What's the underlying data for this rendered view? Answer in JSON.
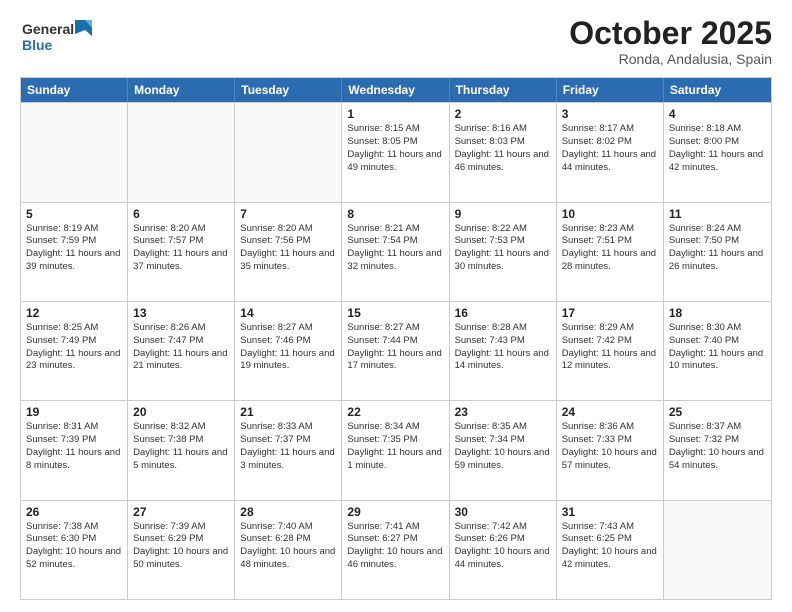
{
  "header": {
    "logo_general": "General",
    "logo_blue": "Blue",
    "month_title": "October 2025",
    "location": "Ronda, Andalusia, Spain"
  },
  "weekdays": [
    "Sunday",
    "Monday",
    "Tuesday",
    "Wednesday",
    "Thursday",
    "Friday",
    "Saturday"
  ],
  "rows": [
    [
      {
        "day": "",
        "text": ""
      },
      {
        "day": "",
        "text": ""
      },
      {
        "day": "",
        "text": ""
      },
      {
        "day": "1",
        "text": "Sunrise: 8:15 AM\nSunset: 8:05 PM\nDaylight: 11 hours and 49 minutes."
      },
      {
        "day": "2",
        "text": "Sunrise: 8:16 AM\nSunset: 8:03 PM\nDaylight: 11 hours and 46 minutes."
      },
      {
        "day": "3",
        "text": "Sunrise: 8:17 AM\nSunset: 8:02 PM\nDaylight: 11 hours and 44 minutes."
      },
      {
        "day": "4",
        "text": "Sunrise: 8:18 AM\nSunset: 8:00 PM\nDaylight: 11 hours and 42 minutes."
      }
    ],
    [
      {
        "day": "5",
        "text": "Sunrise: 8:19 AM\nSunset: 7:59 PM\nDaylight: 11 hours and 39 minutes."
      },
      {
        "day": "6",
        "text": "Sunrise: 8:20 AM\nSunset: 7:57 PM\nDaylight: 11 hours and 37 minutes."
      },
      {
        "day": "7",
        "text": "Sunrise: 8:20 AM\nSunset: 7:56 PM\nDaylight: 11 hours and 35 minutes."
      },
      {
        "day": "8",
        "text": "Sunrise: 8:21 AM\nSunset: 7:54 PM\nDaylight: 11 hours and 32 minutes."
      },
      {
        "day": "9",
        "text": "Sunrise: 8:22 AM\nSunset: 7:53 PM\nDaylight: 11 hours and 30 minutes."
      },
      {
        "day": "10",
        "text": "Sunrise: 8:23 AM\nSunset: 7:51 PM\nDaylight: 11 hours and 28 minutes."
      },
      {
        "day": "11",
        "text": "Sunrise: 8:24 AM\nSunset: 7:50 PM\nDaylight: 11 hours and 26 minutes."
      }
    ],
    [
      {
        "day": "12",
        "text": "Sunrise: 8:25 AM\nSunset: 7:49 PM\nDaylight: 11 hours and 23 minutes."
      },
      {
        "day": "13",
        "text": "Sunrise: 8:26 AM\nSunset: 7:47 PM\nDaylight: 11 hours and 21 minutes."
      },
      {
        "day": "14",
        "text": "Sunrise: 8:27 AM\nSunset: 7:46 PM\nDaylight: 11 hours and 19 minutes."
      },
      {
        "day": "15",
        "text": "Sunrise: 8:27 AM\nSunset: 7:44 PM\nDaylight: 11 hours and 17 minutes."
      },
      {
        "day": "16",
        "text": "Sunrise: 8:28 AM\nSunset: 7:43 PM\nDaylight: 11 hours and 14 minutes."
      },
      {
        "day": "17",
        "text": "Sunrise: 8:29 AM\nSunset: 7:42 PM\nDaylight: 11 hours and 12 minutes."
      },
      {
        "day": "18",
        "text": "Sunrise: 8:30 AM\nSunset: 7:40 PM\nDaylight: 11 hours and 10 minutes."
      }
    ],
    [
      {
        "day": "19",
        "text": "Sunrise: 8:31 AM\nSunset: 7:39 PM\nDaylight: 11 hours and 8 minutes."
      },
      {
        "day": "20",
        "text": "Sunrise: 8:32 AM\nSunset: 7:38 PM\nDaylight: 11 hours and 5 minutes."
      },
      {
        "day": "21",
        "text": "Sunrise: 8:33 AM\nSunset: 7:37 PM\nDaylight: 11 hours and 3 minutes."
      },
      {
        "day": "22",
        "text": "Sunrise: 8:34 AM\nSunset: 7:35 PM\nDaylight: 11 hours and 1 minute."
      },
      {
        "day": "23",
        "text": "Sunrise: 8:35 AM\nSunset: 7:34 PM\nDaylight: 10 hours and 59 minutes."
      },
      {
        "day": "24",
        "text": "Sunrise: 8:36 AM\nSunset: 7:33 PM\nDaylight: 10 hours and 57 minutes."
      },
      {
        "day": "25",
        "text": "Sunrise: 8:37 AM\nSunset: 7:32 PM\nDaylight: 10 hours and 54 minutes."
      }
    ],
    [
      {
        "day": "26",
        "text": "Sunrise: 7:38 AM\nSunset: 6:30 PM\nDaylight: 10 hours and 52 minutes."
      },
      {
        "day": "27",
        "text": "Sunrise: 7:39 AM\nSunset: 6:29 PM\nDaylight: 10 hours and 50 minutes."
      },
      {
        "day": "28",
        "text": "Sunrise: 7:40 AM\nSunset: 6:28 PM\nDaylight: 10 hours and 48 minutes."
      },
      {
        "day": "29",
        "text": "Sunrise: 7:41 AM\nSunset: 6:27 PM\nDaylight: 10 hours and 46 minutes."
      },
      {
        "day": "30",
        "text": "Sunrise: 7:42 AM\nSunset: 6:26 PM\nDaylight: 10 hours and 44 minutes."
      },
      {
        "day": "31",
        "text": "Sunrise: 7:43 AM\nSunset: 6:25 PM\nDaylight: 10 hours and 42 minutes."
      },
      {
        "day": "",
        "text": ""
      }
    ]
  ]
}
